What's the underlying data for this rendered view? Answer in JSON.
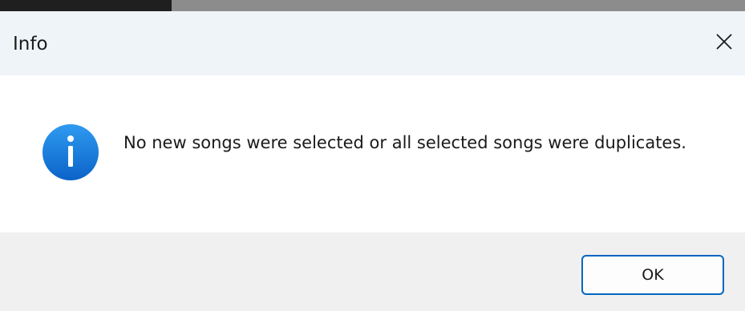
{
  "window": {
    "title": "Info",
    "close_icon": "close-icon"
  },
  "message": {
    "icon": "info-icon",
    "text": "No new songs were selected or all selected songs were duplicates."
  },
  "buttons": {
    "ok_label": "OK"
  },
  "colors": {
    "titlebar_bg": "#eff4f9",
    "footer_bg": "#f0f0f0",
    "accent": "#0067c0",
    "icon_blue": "#1976d2"
  }
}
